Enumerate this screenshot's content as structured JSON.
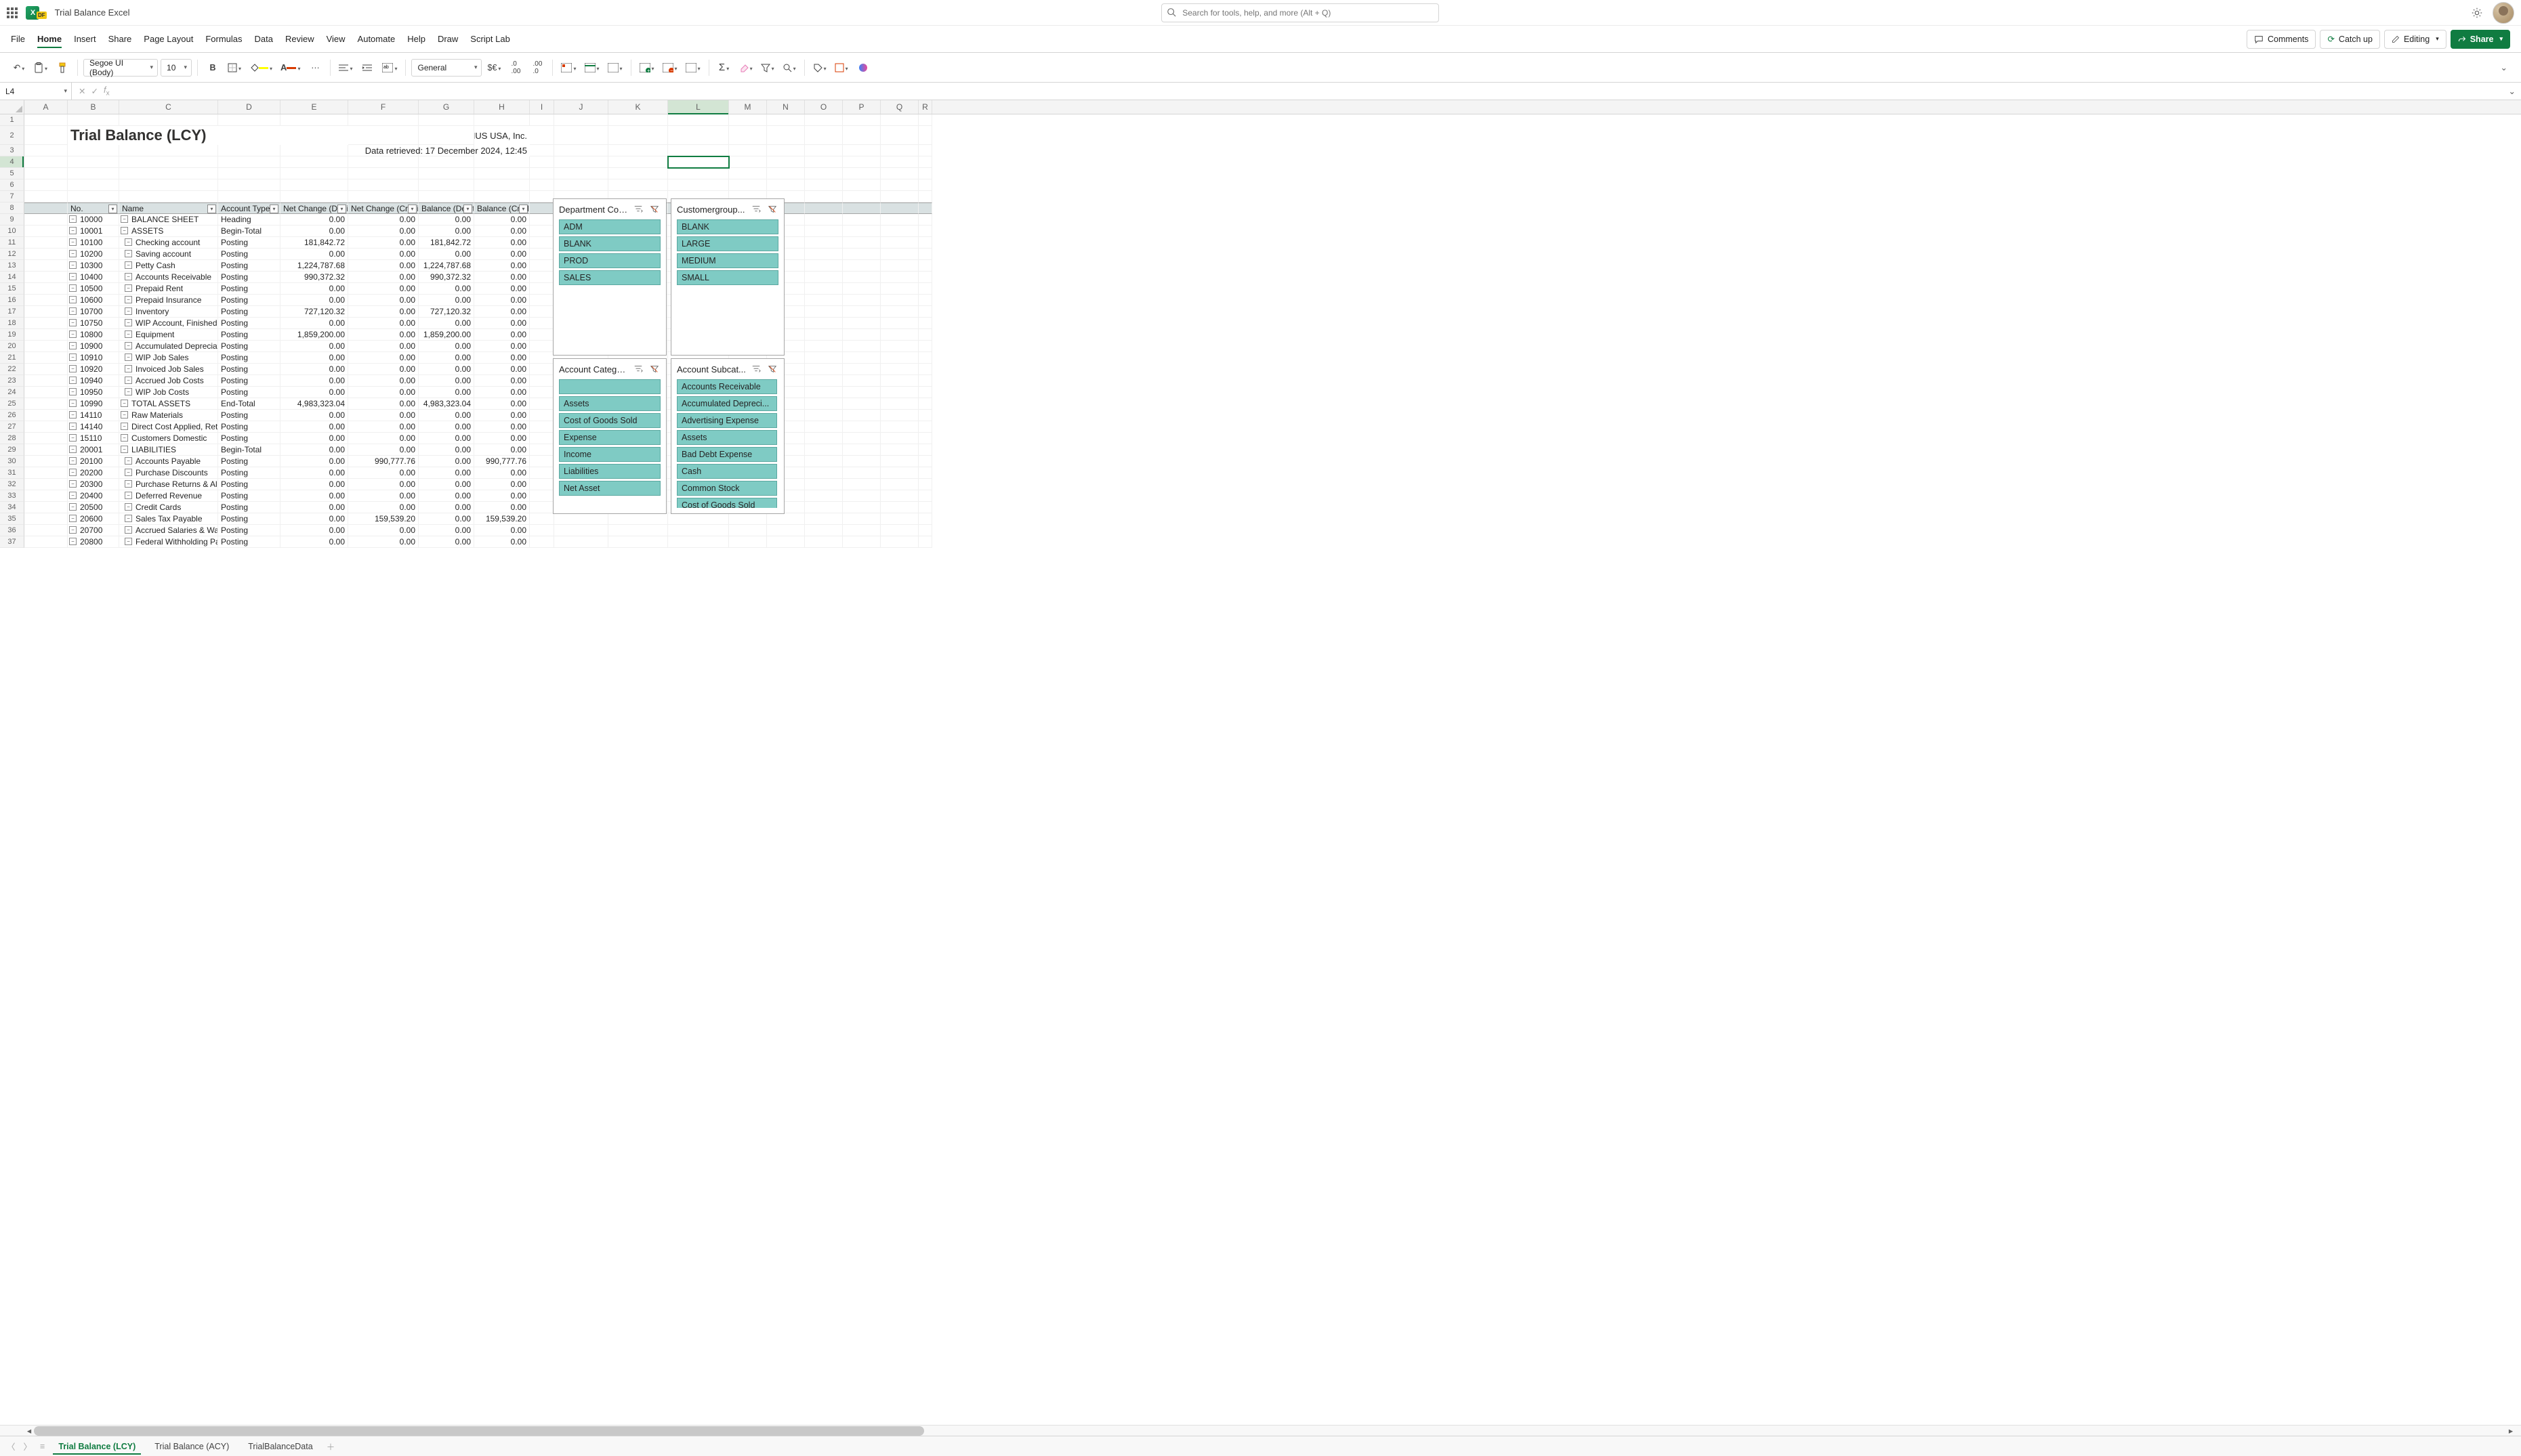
{
  "titlebar": {
    "docName": "Trial Balance Excel",
    "searchPlaceholder": "Search for tools, help, and more (Alt + Q)"
  },
  "tabs": [
    "File",
    "Home",
    "Insert",
    "Share",
    "Page Layout",
    "Formulas",
    "Data",
    "Review",
    "View",
    "Automate",
    "Help",
    "Draw",
    "Script Lab"
  ],
  "activeTab": "Home",
  "actions": {
    "comments": "Comments",
    "catchup": "Catch up",
    "editing": "Editing",
    "share": "Share"
  },
  "ribbon": {
    "fontName": "Segoe UI (Body)",
    "fontSize": "10",
    "numberFormat": "General"
  },
  "formula": {
    "nameBox": "L4",
    "value": ""
  },
  "cols": [
    {
      "l": "A",
      "w": 64
    },
    {
      "l": "B",
      "w": 76
    },
    {
      "l": "C",
      "w": 146
    },
    {
      "l": "D",
      "w": 92
    },
    {
      "l": "E",
      "w": 100
    },
    {
      "l": "F",
      "w": 104
    },
    {
      "l": "G",
      "w": 82
    },
    {
      "l": "H",
      "w": 82
    },
    {
      "l": "I",
      "w": 36
    },
    {
      "l": "J",
      "w": 80
    },
    {
      "l": "K",
      "w": 88
    },
    {
      "l": "L",
      "w": 90
    },
    {
      "l": "M",
      "w": 56
    },
    {
      "l": "N",
      "w": 56
    },
    {
      "l": "O",
      "w": 56
    },
    {
      "l": "P",
      "w": 56
    },
    {
      "l": "Q",
      "w": 56
    },
    {
      "l": "R",
      "w": 20
    }
  ],
  "selectedCol": "L",
  "selectedRow": 4,
  "title": "Trial Balance (LCY)",
  "company": "CRONUS USA, Inc.",
  "retrieved": "Data retrieved: 17 December 2024, 12:45",
  "tableHeaders": [
    "No.",
    "Name",
    "Account Type",
    "Net Change (Debit)",
    "Net Change (Credit)",
    "Balance (Debit)",
    "Balance (Credit)"
  ],
  "rows": [
    {
      "no": "10000",
      "name": "BALANCE SHEET",
      "type": "Heading",
      "d": "0.00",
      "c": "0.00",
      "bd": "0.00",
      "bc": "0.00",
      "lvl": 0
    },
    {
      "no": "10001",
      "name": "ASSETS",
      "type": "Begin-Total",
      "d": "0.00",
      "c": "0.00",
      "bd": "0.00",
      "bc": "0.00",
      "lvl": 0
    },
    {
      "no": "10100",
      "name": "Checking account",
      "type": "Posting",
      "d": "181,842.72",
      "c": "0.00",
      "bd": "181,842.72",
      "bc": "0.00",
      "lvl": 1
    },
    {
      "no": "10200",
      "name": "Saving account",
      "type": "Posting",
      "d": "0.00",
      "c": "0.00",
      "bd": "0.00",
      "bc": "0.00",
      "lvl": 1
    },
    {
      "no": "10300",
      "name": "Petty Cash",
      "type": "Posting",
      "d": "1,224,787.68",
      "c": "0.00",
      "bd": "1,224,787.68",
      "bc": "0.00",
      "lvl": 1
    },
    {
      "no": "10400",
      "name": "Accounts Receivable",
      "type": "Posting",
      "d": "990,372.32",
      "c": "0.00",
      "bd": "990,372.32",
      "bc": "0.00",
      "lvl": 1
    },
    {
      "no": "10500",
      "name": "Prepaid Rent",
      "type": "Posting",
      "d": "0.00",
      "c": "0.00",
      "bd": "0.00",
      "bc": "0.00",
      "lvl": 1
    },
    {
      "no": "10600",
      "name": "Prepaid Insurance",
      "type": "Posting",
      "d": "0.00",
      "c": "0.00",
      "bd": "0.00",
      "bc": "0.00",
      "lvl": 1
    },
    {
      "no": "10700",
      "name": "Inventory",
      "type": "Posting",
      "d": "727,120.32",
      "c": "0.00",
      "bd": "727,120.32",
      "bc": "0.00",
      "lvl": 1
    },
    {
      "no": "10750",
      "name": "WIP Account, Finished g",
      "type": "Posting",
      "d": "0.00",
      "c": "0.00",
      "bd": "0.00",
      "bc": "0.00",
      "lvl": 1
    },
    {
      "no": "10800",
      "name": "Equipment",
      "type": "Posting",
      "d": "1,859,200.00",
      "c": "0.00",
      "bd": "1,859,200.00",
      "bc": "0.00",
      "lvl": 1
    },
    {
      "no": "10900",
      "name": "Accumulated Depreciat",
      "type": "Posting",
      "d": "0.00",
      "c": "0.00",
      "bd": "0.00",
      "bc": "0.00",
      "lvl": 1
    },
    {
      "no": "10910",
      "name": "WIP Job Sales",
      "type": "Posting",
      "d": "0.00",
      "c": "0.00",
      "bd": "0.00",
      "bc": "0.00",
      "lvl": 1
    },
    {
      "no": "10920",
      "name": "Invoiced Job Sales",
      "type": "Posting",
      "d": "0.00",
      "c": "0.00",
      "bd": "0.00",
      "bc": "0.00",
      "lvl": 1
    },
    {
      "no": "10940",
      "name": "Accrued Job Costs",
      "type": "Posting",
      "d": "0.00",
      "c": "0.00",
      "bd": "0.00",
      "bc": "0.00",
      "lvl": 1
    },
    {
      "no": "10950",
      "name": "WIP Job Costs",
      "type": "Posting",
      "d": "0.00",
      "c": "0.00",
      "bd": "0.00",
      "bc": "0.00",
      "lvl": 1
    },
    {
      "no": "10990",
      "name": "TOTAL ASSETS",
      "type": "End-Total",
      "d": "4,983,323.04",
      "c": "0.00",
      "bd": "4,983,323.04",
      "bc": "0.00",
      "lvl": 0
    },
    {
      "no": "14110",
      "name": "Raw Materials",
      "type": "Posting",
      "d": "0.00",
      "c": "0.00",
      "bd": "0.00",
      "bc": "0.00",
      "lvl": 0
    },
    {
      "no": "14140",
      "name": "Direct Cost Applied, Reta",
      "type": "Posting",
      "d": "0.00",
      "c": "0.00",
      "bd": "0.00",
      "bc": "0.00",
      "lvl": 0
    },
    {
      "no": "15110",
      "name": "Customers Domestic",
      "type": "Posting",
      "d": "0.00",
      "c": "0.00",
      "bd": "0.00",
      "bc": "0.00",
      "lvl": 0
    },
    {
      "no": "20001",
      "name": "LIABILITIES",
      "type": "Begin-Total",
      "d": "0.00",
      "c": "0.00",
      "bd": "0.00",
      "bc": "0.00",
      "lvl": 0
    },
    {
      "no": "20100",
      "name": "Accounts Payable",
      "type": "Posting",
      "d": "0.00",
      "c": "990,777.76",
      "bd": "0.00",
      "bc": "990,777.76",
      "lvl": 1
    },
    {
      "no": "20200",
      "name": "Purchase Discounts",
      "type": "Posting",
      "d": "0.00",
      "c": "0.00",
      "bd": "0.00",
      "bc": "0.00",
      "lvl": 1
    },
    {
      "no": "20300",
      "name": "Purchase Returns & Allo",
      "type": "Posting",
      "d": "0.00",
      "c": "0.00",
      "bd": "0.00",
      "bc": "0.00",
      "lvl": 1
    },
    {
      "no": "20400",
      "name": "Deferred Revenue",
      "type": "Posting",
      "d": "0.00",
      "c": "0.00",
      "bd": "0.00",
      "bc": "0.00",
      "lvl": 1
    },
    {
      "no": "20500",
      "name": "Credit Cards",
      "type": "Posting",
      "d": "0.00",
      "c": "0.00",
      "bd": "0.00",
      "bc": "0.00",
      "lvl": 1
    },
    {
      "no": "20600",
      "name": "Sales Tax Payable",
      "type": "Posting",
      "d": "0.00",
      "c": "159,539.20",
      "bd": "0.00",
      "bc": "159,539.20",
      "lvl": 1
    },
    {
      "no": "20700",
      "name": "Accrued Salaries & Wag",
      "type": "Posting",
      "d": "0.00",
      "c": "0.00",
      "bd": "0.00",
      "bc": "0.00",
      "lvl": 1
    },
    {
      "no": "20800",
      "name": "Federal Withholding Pa",
      "type": "Posting",
      "d": "0.00",
      "c": "0.00",
      "bd": "0.00",
      "bc": "0.00",
      "lvl": 1
    }
  ],
  "slicers": {
    "dept": {
      "title": "Department Code",
      "items": [
        "ADM",
        "BLANK",
        "PROD",
        "SALES"
      ]
    },
    "cust": {
      "title": "Customergroup...",
      "items": [
        "BLANK",
        "LARGE",
        "MEDIUM",
        "SMALL"
      ]
    },
    "acat": {
      "title": "Account Category",
      "items": [
        "",
        "Assets",
        "Cost of Goods Sold",
        "Expense",
        "Income",
        "Liabilities",
        "Net Asset"
      ]
    },
    "asub": {
      "title": "Account Subcat...",
      "items": [
        "Accounts Receivable",
        "Accumulated Depreci...",
        "Advertising Expense",
        "Assets",
        "Bad Debt Expense",
        "Cash",
        "Common Stock",
        "Cost of Goods Sold"
      ]
    }
  },
  "sheets": [
    "Trial Balance (LCY)",
    "Trial Balance (ACY)",
    "TrialBalanceData"
  ],
  "activeSheet": "Trial Balance (LCY)"
}
